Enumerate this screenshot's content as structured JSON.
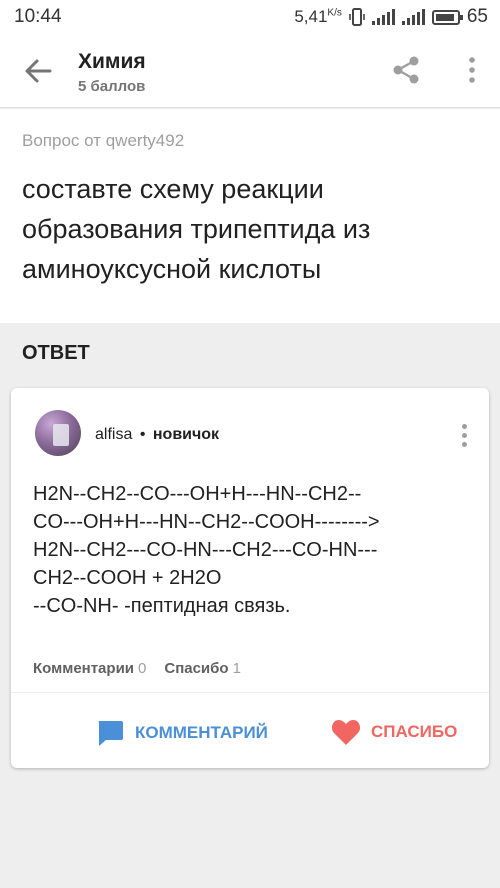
{
  "statusbar": {
    "time": "10:44",
    "speed": "5,41",
    "speed_unit": "K/s",
    "battery": "65"
  },
  "appbar": {
    "title": "Химия",
    "subtitle": "5 баллов"
  },
  "question": {
    "meta": "Вопрос от qwerty492",
    "text": "составте схему реакции образования трипептида из аминоуксусной кислоты"
  },
  "answer_heading": "ОТВЕТ",
  "answer": {
    "author_name": "alfisa",
    "author_separator": "•",
    "author_rank": "новичок",
    "lines": [
      "H2N--CH2--CO---OH+H---HN--CH2--",
      "CO---OH+H---HN--CH2--COOH-------->",
      "H2N--CH2---CO-HN---CH2---CO-HN---",
      "CH2--COOH + 2H2O",
      "--CO-NH- -пептидная связь."
    ],
    "comments_label": "Комментарии",
    "comments_count": "0",
    "thanks_label": "Спасибо",
    "thanks_count": "1"
  },
  "actions": {
    "comment_label": "КОММЕНТАРИЙ",
    "thanks_label": "СПАСИБО"
  },
  "colors": {
    "accent_blue": "#4a90d9",
    "accent_red": "#f16660",
    "background": "#eeeeee"
  },
  "icons": [
    "back-arrow-icon",
    "share-icon",
    "more-vert-icon",
    "comment-icon",
    "heart-icon",
    "wifi-icon",
    "signal-icon",
    "battery-icon",
    "vibrate-icon"
  ]
}
